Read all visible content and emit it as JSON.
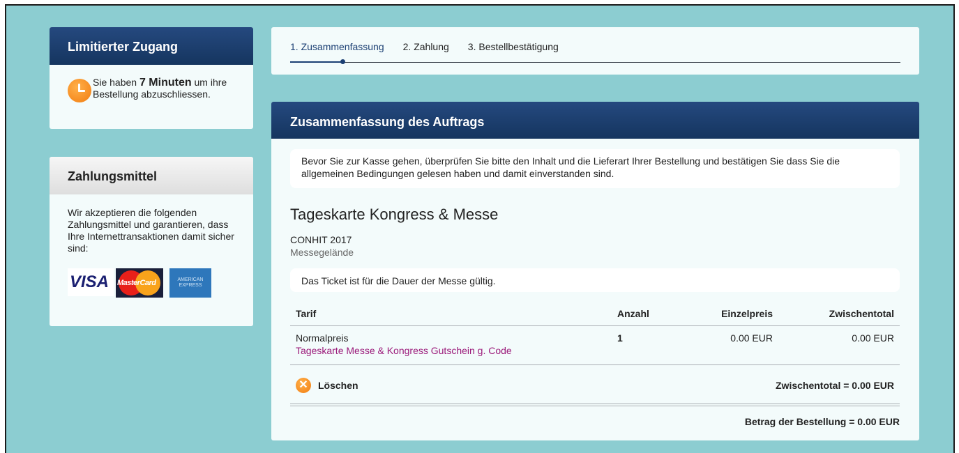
{
  "limited_access": {
    "title": "Limitierter Zugang",
    "text_before": "Sie haben ",
    "minutes": "7 Minuten",
    "text_after": " um ihre Bestellung abzuschliessen.",
    "icon": "clock-icon"
  },
  "payment": {
    "title": "Zahlungsmittel",
    "text": "Wir akzeptieren die folgenden Zahlungsmittel und garantieren, dass Ihre Internettransaktionen damit sicher sind:",
    "cards": [
      "visa",
      "mastercard",
      "american-express"
    ],
    "visa_label": "VISA",
    "mc_label": "MasterCard",
    "amex_label": "AMERICAN EXPRESS"
  },
  "steps": [
    {
      "label": "1. Zusammenfassung",
      "active": true
    },
    {
      "label": "2. Zahlung",
      "active": false
    },
    {
      "label": "3. Bestellbestätigung",
      "active": false
    }
  ],
  "summary": {
    "title": "Zusammenfassung des Auftrags",
    "intro": "Bevor Sie zur Kasse gehen, überprüfen Sie bitte den Inhalt und die Lieferart Ihrer Bestellung und bestätigen Sie dass Sie die allgemeinen Bedingungen gelesen haben und damit einverstanden sind.",
    "ticket_title": "Tageskarte Kongress & Messe",
    "event": "CONHIT 2017",
    "venue": "Messegelände",
    "validity": "Das Ticket ist für die Dauer der Messe gültig.",
    "table": {
      "headers": {
        "tarif": "Tarif",
        "anzahl": "Anzahl",
        "einzelpreis": "Einzelpreis",
        "zwischentotal": "Zwischentotal"
      },
      "row": {
        "tarif": "Normalpreis",
        "coupon": "Tageskarte Messe & Kongress Gutschein g. Code",
        "anzahl": "1",
        "einzelpreis": "0.00 EUR",
        "zwischentotal": "0.00 EUR"
      },
      "delete_label": "Löschen",
      "subtotal": "Zwischentotal = 0.00 EUR",
      "order_total": "Betrag der Bestellung = 0.00 EUR"
    }
  },
  "colors": {
    "background": "#8ccdd1",
    "header_blue": "#1b3f73",
    "accent_orange": "#f27d10",
    "coupon_purple": "#9b1a7a"
  }
}
